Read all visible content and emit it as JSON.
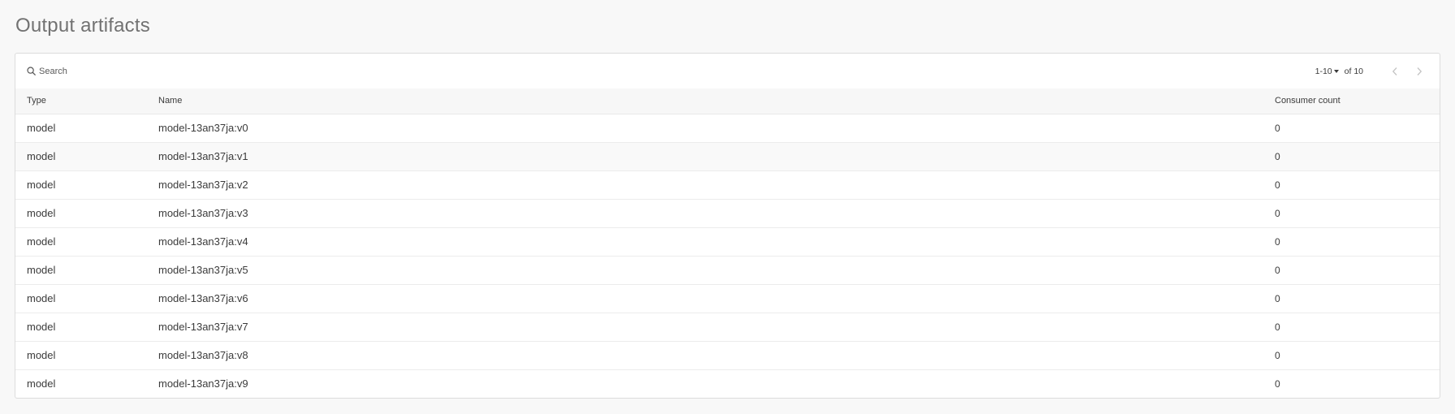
{
  "section": {
    "title": "Output artifacts"
  },
  "search": {
    "placeholder": "Search",
    "value": ""
  },
  "pagination": {
    "range": "1-10",
    "of_label": "of 10"
  },
  "icons": {
    "search": "search-icon",
    "range_dropdown": "caret-down-icon",
    "prev": "chevron-left-icon",
    "next": "chevron-right-icon"
  },
  "table": {
    "columns": [
      "Type",
      "Name",
      "Consumer count"
    ],
    "rows": [
      {
        "type": "model",
        "name": "model-13an37ja:v0",
        "consumer_count": "0"
      },
      {
        "type": "model",
        "name": "model-13an37ja:v1",
        "consumer_count": "0"
      },
      {
        "type": "model",
        "name": "model-13an37ja:v2",
        "consumer_count": "0"
      },
      {
        "type": "model",
        "name": "model-13an37ja:v3",
        "consumer_count": "0"
      },
      {
        "type": "model",
        "name": "model-13an37ja:v4",
        "consumer_count": "0"
      },
      {
        "type": "model",
        "name": "model-13an37ja:v5",
        "consumer_count": "0"
      },
      {
        "type": "model",
        "name": "model-13an37ja:v6",
        "consumer_count": "0"
      },
      {
        "type": "model",
        "name": "model-13an37ja:v7",
        "consumer_count": "0"
      },
      {
        "type": "model",
        "name": "model-13an37ja:v8",
        "consumer_count": "0"
      },
      {
        "type": "model",
        "name": "model-13an37ja:v9",
        "consumer_count": "0"
      }
    ]
  }
}
